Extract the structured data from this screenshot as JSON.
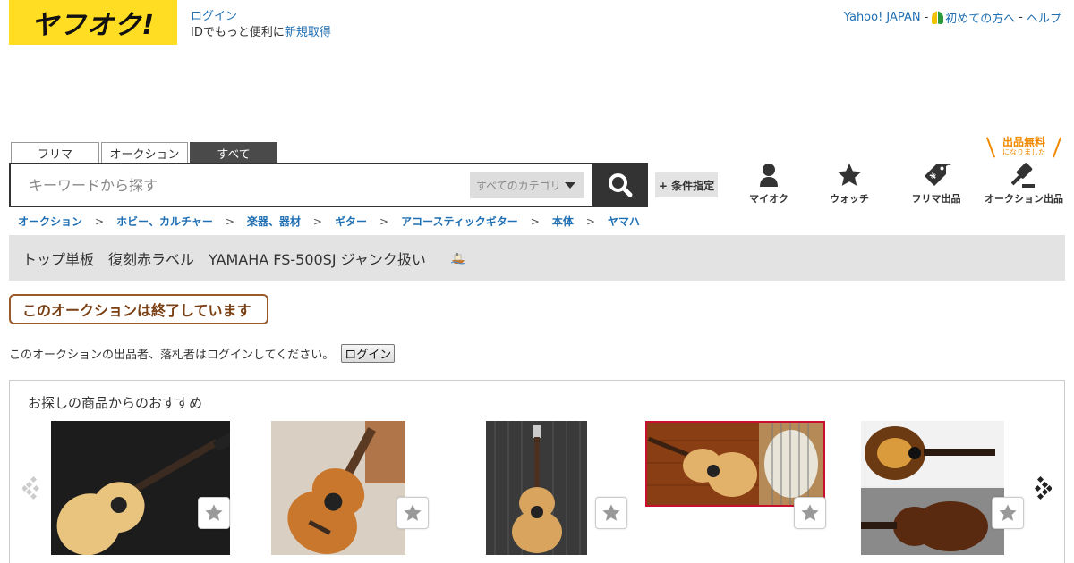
{
  "header": {
    "logo_text": "ヤフオク!",
    "login_link": "ログイン",
    "id_prompt": "IDでもっと便利に",
    "signup_link": "新規取得",
    "top_links": {
      "yahoo_japan": "Yahoo! JAPAN",
      "beginners": "初めての方へ",
      "help": "ヘルプ",
      "separator": "-"
    }
  },
  "tabs": [
    {
      "label": "フリマ",
      "active": false
    },
    {
      "label": "オークション",
      "active": false
    },
    {
      "label": "すべて",
      "active": true
    }
  ],
  "search": {
    "placeholder": "キーワードから探す",
    "value": "",
    "category": "すべてのカテゴリ",
    "conditions_label": "+ 条件指定"
  },
  "right_nav": {
    "free_badge_main": "出品無料",
    "free_badge_sub": "になりました",
    "items": [
      {
        "label": "マイオク",
        "icon": "person-icon"
      },
      {
        "label": "ウォッチ",
        "icon": "star-icon"
      },
      {
        "label": "フリマ出品",
        "icon": "price-tag-icon"
      },
      {
        "label": "オークション出品",
        "icon": "gavel-icon"
      }
    ]
  },
  "breadcrumb": {
    "items": [
      "オークション",
      "ホビー、カルチャー",
      "楽器、器材",
      "ギター",
      "アコースティックギター",
      "本体",
      "ヤマハ"
    ],
    "separator": ">"
  },
  "item_title": "トップ単板　復刻赤ラベル　YAMAHA FS-500SJ ジャンク扱い",
  "status": {
    "ended_message": "このオークションは終了しています",
    "login_note": "このオークションの出品者、落札者はログインしてください。",
    "login_button": "ログイン"
  },
  "recommendations": {
    "title": "お探しの商品からのおすすめ",
    "items": [
      {
        "image": "acoustic-guitar-photo",
        "watch": "star-icon"
      },
      {
        "image": "acoustic-guitar-photo",
        "watch": "star-icon"
      },
      {
        "image": "acoustic-guitar-photo",
        "watch": "star-icon"
      },
      {
        "image": "acoustic-guitar-photo",
        "watch": "star-icon"
      },
      {
        "image": "sunburst-guitar-photo",
        "watch": "star-icon"
      }
    ]
  },
  "colors": {
    "logo_yellow": "#ffdd22",
    "link_blue": "#1f6fb3",
    "ended_brown": "#7a3f12",
    "free_orange": "#f08a00"
  }
}
